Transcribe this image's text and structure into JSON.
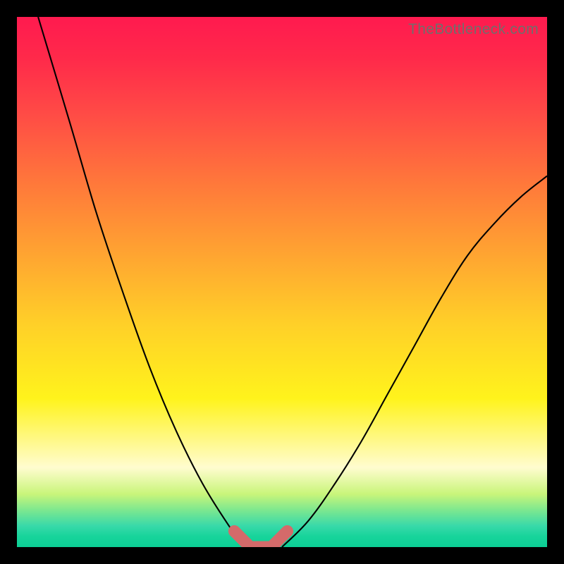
{
  "watermark": "TheBottleneck.com",
  "chart_data": {
    "type": "line",
    "title": "",
    "xlabel": "",
    "ylabel": "",
    "xlim": [
      0,
      100
    ],
    "ylim": [
      0,
      100
    ],
    "series": [
      {
        "name": "bottleneck-curve-left",
        "x": [
          4,
          10,
          15,
          20,
          25,
          30,
          35,
          40,
          43
        ],
        "values": [
          100,
          80,
          63,
          48,
          34,
          22,
          12,
          4,
          0
        ]
      },
      {
        "name": "bottleneck-curve-right",
        "x": [
          50,
          55,
          60,
          65,
          70,
          75,
          80,
          85,
          90,
          95,
          100
        ],
        "values": [
          0,
          5,
          12,
          20,
          29,
          38,
          47,
          55,
          61,
          66,
          70
        ]
      },
      {
        "name": "optimal-zone",
        "x": [
          41,
          44,
          48,
          51
        ],
        "values": [
          3,
          0,
          0,
          3
        ]
      }
    ],
    "colors": {
      "curve": "#000000",
      "optimal_zone": "#d46a6a"
    }
  }
}
